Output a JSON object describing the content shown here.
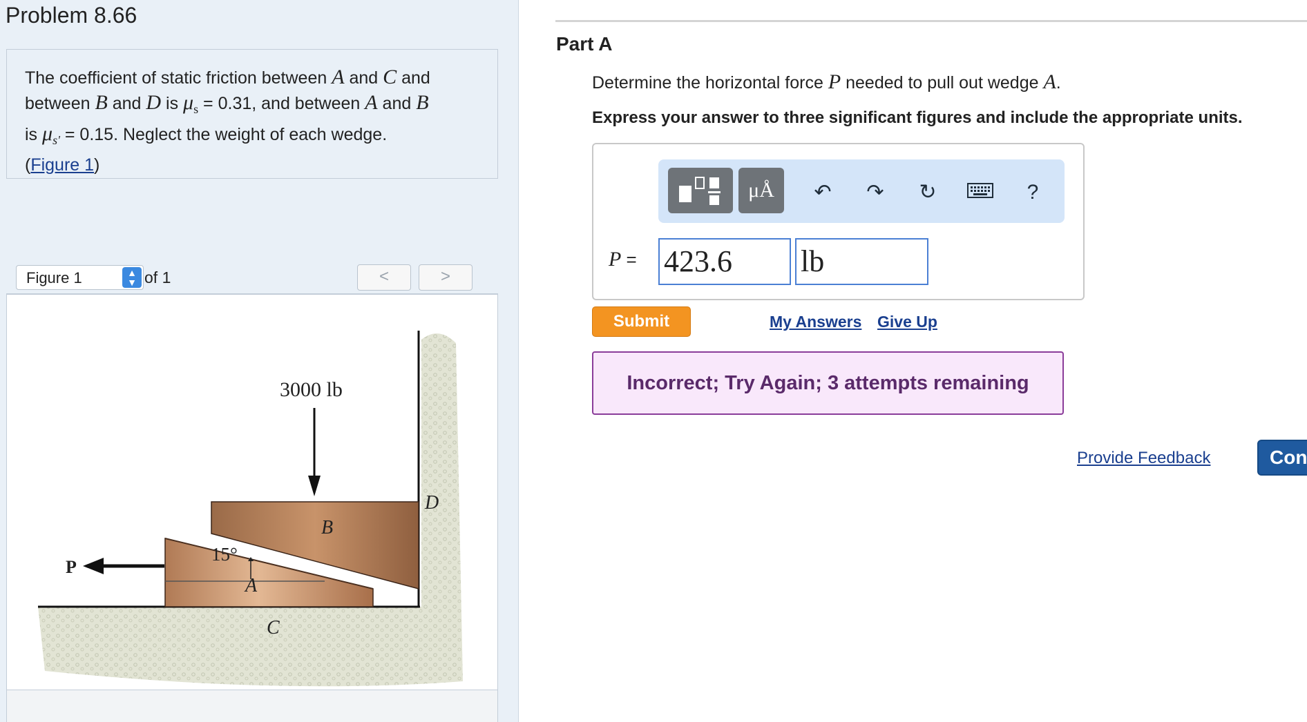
{
  "problem": {
    "title": "Problem 8.66",
    "text_1": "The coefficient of static friction between ",
    "var_a": "A",
    "text_2": " and ",
    "var_c": "C",
    "text_3": " and",
    "text_4": "between ",
    "var_b": "B",
    "text_5": " and ",
    "var_d": "D",
    "text_6": " is ",
    "mu_s_label": "μ",
    "mu_s_sub": "s",
    "text_7": " = 0.31, and between ",
    "var_a2": "A",
    "text_8": " and ",
    "var_b2": "B",
    "text_9": "is ",
    "mu_s2_label": "μ",
    "mu_s2_sub": "s'",
    "text_10": " = 0.15. Neglect the weight of each wedge.",
    "figure_link_open": "(",
    "figure_link": "Figure 1",
    "figure_link_close": ")"
  },
  "figure_nav": {
    "selected": "Figure 1",
    "of_label": "of 1",
    "prev": "<",
    "next": ">"
  },
  "figure": {
    "load_label": "3000 lb",
    "label_b": "B",
    "label_d": "D",
    "label_a": "A",
    "label_c": "C",
    "label_p": "P",
    "angle_label": "15°"
  },
  "part": {
    "title": "Part A",
    "question_1": "Determine the horizontal force ",
    "var_p": "P",
    "question_2": " needed to pull out wedge ",
    "var_a": "A",
    "question_3": ".",
    "instruction": "Express your answer to three significant figures and include the appropriate units."
  },
  "toolbar": {
    "units_btn": "μÅ",
    "help": "?"
  },
  "answer": {
    "label_var": "P",
    "label_eq": " =",
    "value": "423.6",
    "unit": "lb"
  },
  "actions": {
    "submit": "Submit",
    "my_answers": "My Answers",
    "give_up": "Give Up"
  },
  "feedback": {
    "message": "Incorrect; Try Again; 3 attempts remaining"
  },
  "footer": {
    "provide_feedback": "Provide Feedback",
    "continue": "Con"
  },
  "colors": {
    "accent_orange": "#f39421",
    "link_blue": "#1a3f8f",
    "feedback_purple": "#8a3c99",
    "continue_blue": "#1f5a9f"
  }
}
